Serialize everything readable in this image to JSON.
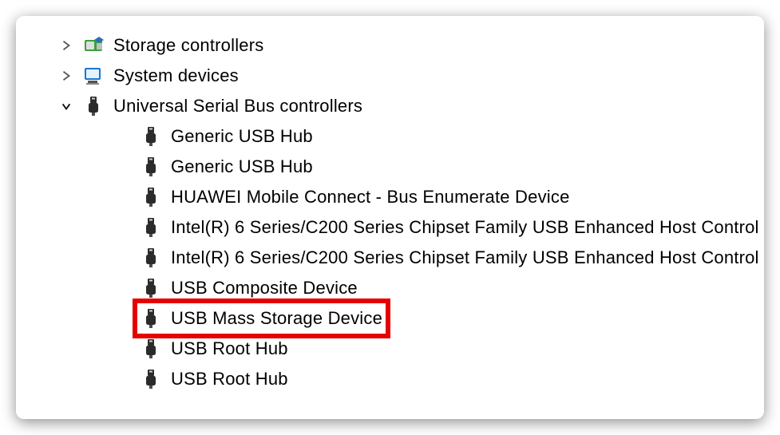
{
  "tree": {
    "nodes": [
      {
        "label": "Storage controllers",
        "level": 0,
        "expander": "collapsed",
        "icon": "storage-controller-icon"
      },
      {
        "label": "System devices",
        "level": 0,
        "expander": "collapsed",
        "icon": "system-device-icon"
      },
      {
        "label": "Universal Serial Bus controllers",
        "level": 0,
        "expander": "expanded",
        "icon": "usb-icon"
      },
      {
        "label": "Generic USB Hub",
        "level": 1,
        "expander": "none",
        "icon": "usb-icon"
      },
      {
        "label": "Generic USB Hub",
        "level": 1,
        "expander": "none",
        "icon": "usb-icon"
      },
      {
        "label": "HUAWEI Mobile Connect - Bus Enumerate Device",
        "level": 1,
        "expander": "none",
        "icon": "usb-icon"
      },
      {
        "label": "Intel(R) 6 Series/C200 Series Chipset Family USB Enhanced Host Control",
        "level": 1,
        "expander": "none",
        "icon": "usb-icon"
      },
      {
        "label": "Intel(R) 6 Series/C200 Series Chipset Family USB Enhanced Host Control",
        "level": 1,
        "expander": "none",
        "icon": "usb-icon"
      },
      {
        "label": "USB Composite Device",
        "level": 1,
        "expander": "none",
        "icon": "usb-icon"
      },
      {
        "label": "USB Mass Storage Device",
        "level": 1,
        "expander": "none",
        "icon": "usb-icon",
        "highlighted": true
      },
      {
        "label": "USB Root Hub",
        "level": 1,
        "expander": "none",
        "icon": "usb-icon"
      },
      {
        "label": "USB Root Hub",
        "level": 1,
        "expander": "none",
        "icon": "usb-icon"
      }
    ]
  },
  "highlight_color": "#e60000"
}
